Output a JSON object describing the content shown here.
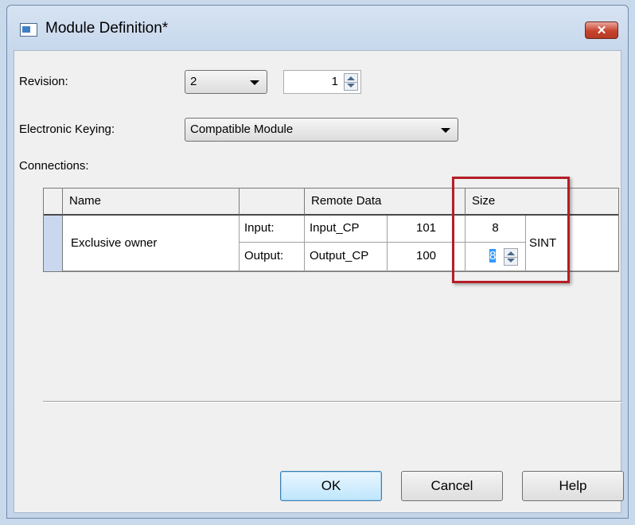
{
  "window": {
    "title": "Module Definition*",
    "close_glyph": "✕",
    "icon": "window-icon"
  },
  "form": {
    "revision_label": "Revision:",
    "revision_major": "2",
    "revision_minor": "1",
    "keying_label": "Electronic Keying:",
    "keying_value": "Compatible Module",
    "connections_label": "Connections:"
  },
  "connections": {
    "headers": {
      "name": "Name",
      "type": "",
      "remote_data": "Remote Data",
      "size": "Size"
    },
    "row": {
      "name": "Exclusive owner",
      "data_type": "SINT",
      "input": {
        "label": "Input:",
        "tag": "Input_CP",
        "instance": "101",
        "size": "8"
      },
      "output": {
        "label": "Output:",
        "tag": "Output_CP",
        "instance": "100",
        "size": "8"
      }
    }
  },
  "buttons": {
    "ok": "OK",
    "cancel": "Cancel",
    "help": "Help"
  },
  "colors": {
    "highlight_border": "#b51e27",
    "close_button": "#c7432d",
    "selection": "#3399ff"
  }
}
